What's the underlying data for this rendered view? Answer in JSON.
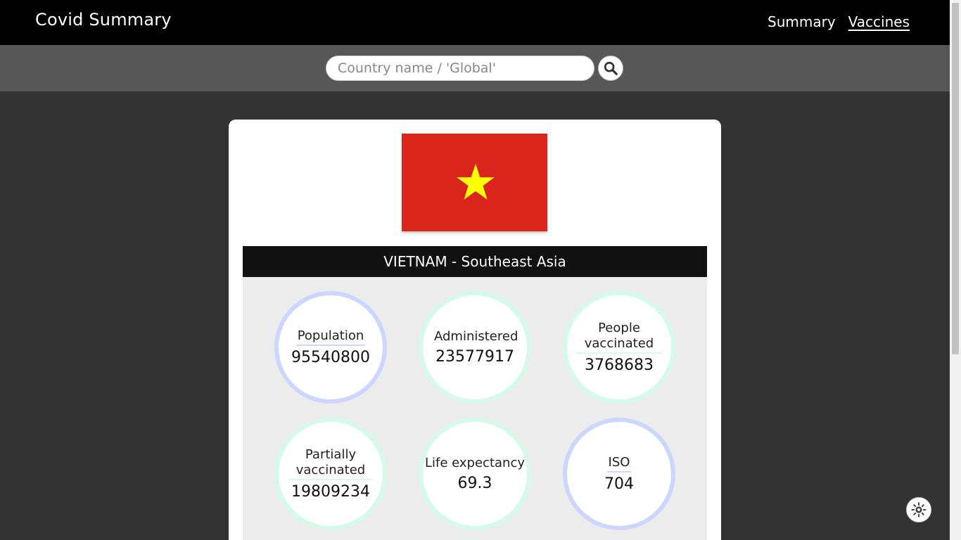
{
  "header": {
    "title": "Covid Summary",
    "nav": [
      {
        "label": "Summary",
        "active": false
      },
      {
        "label": "Vaccines",
        "active": true
      }
    ]
  },
  "search": {
    "placeholder": "Country name / 'Global'",
    "value": "",
    "button_icon": "search-icon"
  },
  "country": {
    "name": "VIETNAM",
    "region": "Southeast Asia",
    "heading": "VIETNAM - Southeast Asia",
    "flag": {
      "background": "#da251d",
      "star": "#ffff00"
    }
  },
  "stats": [
    {
      "label": "Population",
      "value": "95540800",
      "ring": "blue"
    },
    {
      "label": "Administered",
      "value": "23577917",
      "ring": "mint"
    },
    {
      "label": "People vaccinated",
      "value": "3768683",
      "ring": "mint"
    },
    {
      "label": "Partially vaccinated",
      "value": "19809234",
      "ring": "mint"
    },
    {
      "label": "Life expectancy",
      "value": "69.3",
      "ring": "mint"
    },
    {
      "label": "ISO",
      "value": "704",
      "ring": "blue"
    }
  ],
  "theme_toggle_icon": "sun-icon",
  "colors": {
    "topbar": "#000000",
    "searchbar": "#575757",
    "page_bg": "#333333",
    "ring_blue": "#cdd6ff",
    "ring_mint": "#d4fbea"
  }
}
